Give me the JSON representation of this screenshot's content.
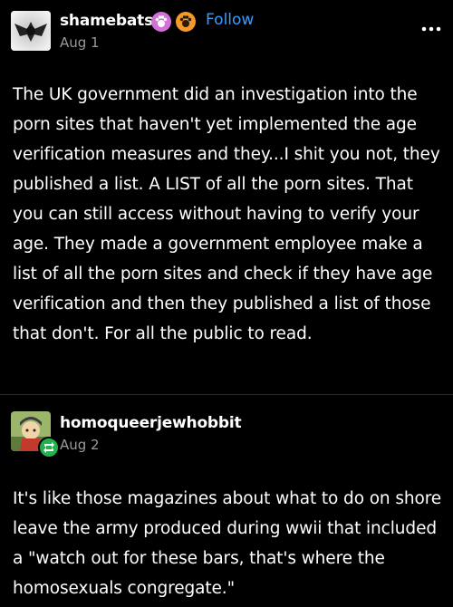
{
  "post1": {
    "username": "shamebats",
    "follow_label": "Follow",
    "date": "Aug 1",
    "text": "The UK government did an investigation into the porn sites that haven't yet implemented the age verification measures and they...I shit you not, they published a list. A LIST of all the porn sites. That you can still access without having to verify your age. They made a government employee make a list of all the porn sites and check if they have age verification and then they published a list of those that don't. For all the public to read."
  },
  "post2": {
    "username": "homoqueerjewhobbit",
    "date": "Aug 2",
    "text": "It's like those magazines about what to do on shore leave the army produced during wwii that included a \"watch out for these bars, that's where the homosexuals congregate.\""
  },
  "colors": {
    "background": "#000000",
    "text": "#ffffff",
    "meta": "#9a9a9a",
    "link": "#3b9cff",
    "badge_pink": "#d56fd9",
    "badge_orange": "#f39a2b",
    "reblog_green": "#22b14c"
  },
  "icons": {
    "more": "more-options-icon",
    "badge1": "paw-badge-icon",
    "badge2": "paw-badge-icon-2",
    "reblog": "reblog-icon"
  }
}
